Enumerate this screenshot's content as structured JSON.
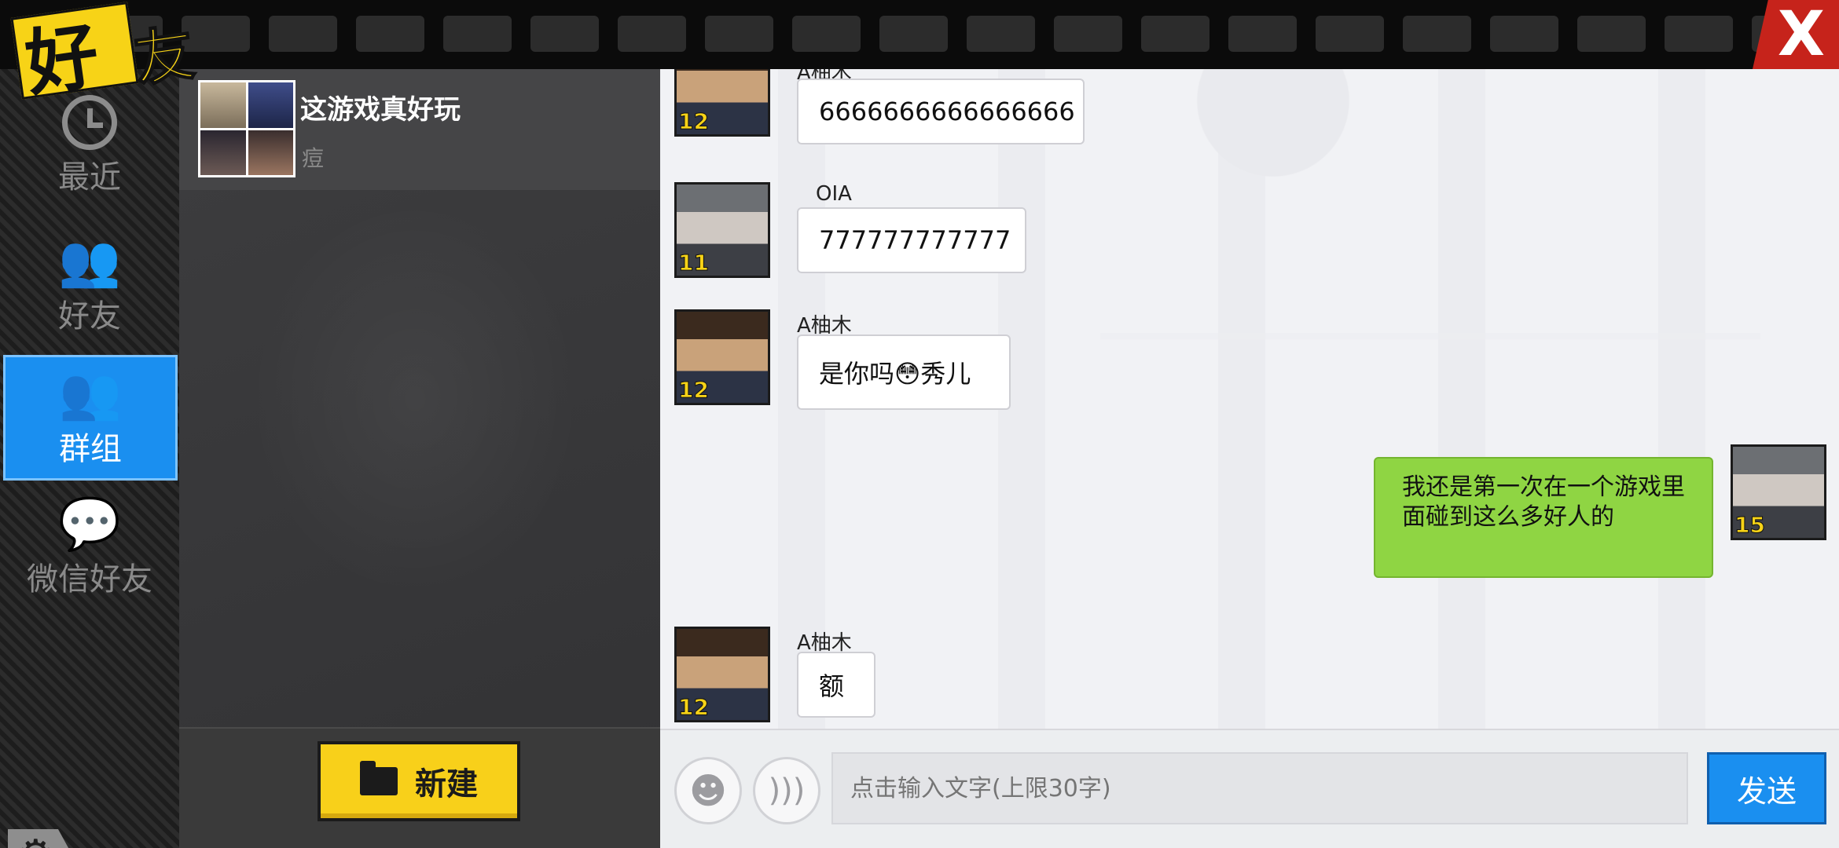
{
  "header": {
    "title_char1": "好",
    "title_char2": "友",
    "close_symbol": "X"
  },
  "sidebar": {
    "items": [
      {
        "label": "最近",
        "icon": "clock-icon"
      },
      {
        "label": "好友",
        "icon": "friends-icon"
      },
      {
        "label": "群组",
        "icon": "group-icon",
        "active": true
      },
      {
        "label": "微信好友",
        "icon": "wechat-icon"
      }
    ],
    "settings_icon": "gear-icon"
  },
  "group_list": {
    "items": [
      {
        "name": "这游戏真好玩",
        "preview": "痘"
      }
    ],
    "new_button": "新建"
  },
  "chat": {
    "messages": [
      {
        "sender": "A柚木",
        "level": "12",
        "text": "6666666666666666",
        "mine": false
      },
      {
        "sender": "OIA",
        "level": "11",
        "text": "777777777777",
        "mine": false
      },
      {
        "sender": "A柚木",
        "level": "12",
        "text": "是你吗😳秀儿",
        "mine": false
      },
      {
        "sender": "",
        "level": "15",
        "text": "我还是第一次在一个游戏里面碰到这么多好人的",
        "mine": true
      },
      {
        "sender": "A柚木",
        "level": "12",
        "text": "额",
        "mine": false
      }
    ]
  },
  "input": {
    "placeholder": "点击输入文字(上限30字)",
    "emoji_icon": "smiley-icon",
    "voice_icon": "voice-icon",
    "send_label": "发送"
  },
  "colors": {
    "accent": "#1a8ff0",
    "new_button": "#f8d01a",
    "my_bubble": "#8fd543",
    "close": "#c6231b"
  }
}
